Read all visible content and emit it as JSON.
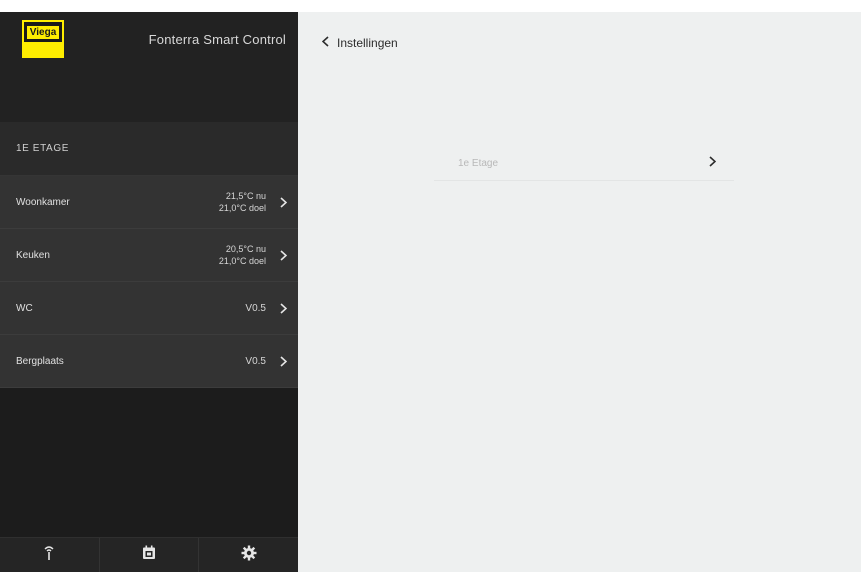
{
  "app": {
    "logo_text": "Viega",
    "title": "Fonterra Smart Control"
  },
  "sidebar": {
    "floor_label": "1E ETAGE",
    "rooms": [
      {
        "name": "Woonkamer",
        "line1": "21,5°C nu",
        "line2": "21,0°C doel"
      },
      {
        "name": "Keuken",
        "line1": "20,5°C nu",
        "line2": "21,0°C doel"
      },
      {
        "name": "WC",
        "value": "V0.5"
      },
      {
        "name": "Bergplaats",
        "value": "V0.5"
      }
    ],
    "bottom_tabs": [
      {
        "icon": "antenna-icon"
      },
      {
        "icon": "calendar-icon"
      },
      {
        "icon": "gear-icon"
      }
    ]
  },
  "main": {
    "back_label": "Instellingen",
    "list_item_label": "1e Etage"
  },
  "colors": {
    "sidebar_bg": "#1c1c1c",
    "row_bg": "#333333",
    "main_bg": "#eef0f0",
    "brand_yellow": "#ffed00"
  }
}
